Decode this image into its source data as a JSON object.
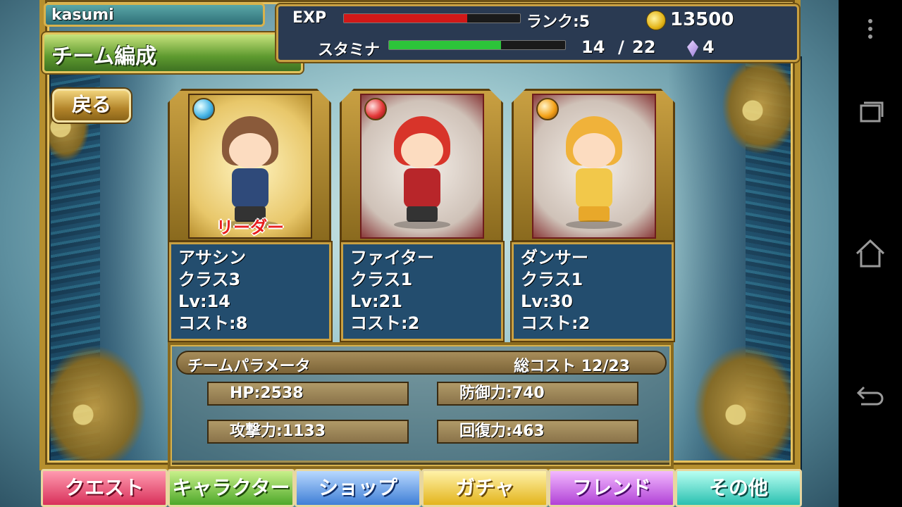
{
  "player": {
    "name": "kasumi",
    "exp_label": "EXP",
    "exp_progress": 0.7,
    "rank": "ランク:5",
    "gold": "13500",
    "stamina_label": "スタミナ",
    "stamina_current": "14",
    "stamina_separator": "/",
    "stamina_max": "22",
    "gems": "4"
  },
  "screen": {
    "title": "チーム編成",
    "back_label": "戻る"
  },
  "team": [
    {
      "gem_color": "blue",
      "leader_label": "リーダー",
      "name": "アサシン",
      "class": "クラス3",
      "level": "Lv:14",
      "cost": "コスト:8"
    },
    {
      "gem_color": "red",
      "name": "ファイター",
      "class": "クラス1",
      "level": "Lv:21",
      "cost": "コスト:2"
    },
    {
      "gem_color": "orange",
      "name": "ダンサー",
      "class": "クラス1",
      "level": "Lv:30",
      "cost": "コスト:2"
    }
  ],
  "params": {
    "title": "チームパラメータ",
    "total_cost": "総コスト 12/23",
    "hp": "HP:2538",
    "defense": "防御力:740",
    "attack": "攻撃力:1133",
    "recovery": "回復力:463"
  },
  "nav": {
    "quest": "クエスト",
    "character": "キャラクター",
    "shop": "ショップ",
    "gacha": "ガチャ",
    "friend": "フレンド",
    "other": "その他"
  },
  "colors": {
    "exp_bar": "#d01818",
    "stamina_bar": "#2cc43a",
    "frame_gold": "#c9a042",
    "info_panel": "#234d6e"
  },
  "icons": {
    "coin": "coin-icon",
    "gem": "gem-icon",
    "system_menu": "overflow-menu-icon",
    "system_recents": "recents-icon",
    "system_home": "home-icon",
    "system_back": "back-icon"
  }
}
